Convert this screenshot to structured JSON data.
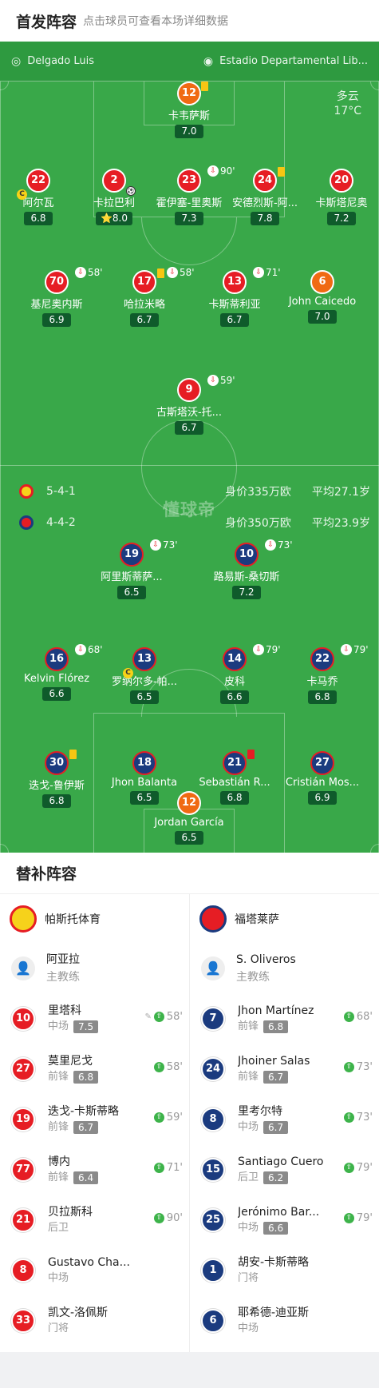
{
  "header": {
    "title": "首发阵容",
    "subtitle": "点击球员可查看本场详细数据"
  },
  "info": {
    "referee": "Delgado Luis",
    "stadium": "Estadio Departamental Lib..."
  },
  "weather": {
    "condition": "多云",
    "temp": "17°C"
  },
  "watermark": "懂球帝",
  "home_team": {
    "formation": "5-4-1",
    "value": "身价335万欧",
    "age": "平均27.1岁"
  },
  "away_team": {
    "formation": "4-4-2",
    "value": "身价350万欧",
    "age": "平均23.9岁"
  },
  "home": [
    {
      "num": "12",
      "name": "卡韦萨斯",
      "rating": "7.0"
    },
    {
      "num": "22",
      "name": "阿尔瓦",
      "rating": "6.8"
    },
    {
      "num": "2",
      "name": "卡拉巴利",
      "rating": "8.0",
      "star": "⭐"
    },
    {
      "num": "23",
      "name": "霍伊塞-里奥斯",
      "rating": "7.3",
      "sub": "90'"
    },
    {
      "num": "24",
      "name": "安德烈斯-阿...",
      "rating": "7.8"
    },
    {
      "num": "20",
      "name": "卡斯塔尼奥",
      "rating": "7.2"
    },
    {
      "num": "70",
      "name": "基尼奥内斯",
      "rating": "6.9",
      "sub": "58'"
    },
    {
      "num": "17",
      "name": "哈拉米略",
      "rating": "6.7",
      "sub": "58'"
    },
    {
      "num": "13",
      "name": "卡斯蒂利亚",
      "rating": "6.7",
      "sub": "71'"
    },
    {
      "num": "6",
      "name": "John Caicedo",
      "rating": "7.0"
    },
    {
      "num": "9",
      "name": "古斯塔沃-托...",
      "rating": "6.7",
      "sub": "59'"
    }
  ],
  "away": [
    {
      "num": "19",
      "name": "阿里斯蒂萨...",
      "rating": "6.5",
      "sub": "73'"
    },
    {
      "num": "10",
      "name": "路易斯-桑切斯",
      "rating": "7.2",
      "sub": "73'"
    },
    {
      "num": "16",
      "name": "Kelvin Flórez",
      "rating": "6.6",
      "sub": "68'"
    },
    {
      "num": "13",
      "name": "罗纳尔多-帕...",
      "rating": "6.5"
    },
    {
      "num": "14",
      "name": "皮科",
      "rating": "6.6",
      "sub": "79'"
    },
    {
      "num": "22",
      "name": "卡马乔",
      "rating": "6.8",
      "sub": "79'"
    },
    {
      "num": "30",
      "name": "迭戈-鲁伊斯",
      "rating": "6.8"
    },
    {
      "num": "18",
      "name": "Jhon Balanta",
      "rating": "6.5"
    },
    {
      "num": "21",
      "name": "Sebastián R...",
      "rating": "6.8"
    },
    {
      "num": "27",
      "name": "Cristián Mos...",
      "rating": "6.9"
    },
    {
      "num": "12",
      "name": "Jordan García",
      "rating": "6.5"
    }
  ],
  "subs": {
    "title": "替补阵容",
    "home_name": "帕斯托体育",
    "away_name": "福塔莱萨",
    "home_coach": {
      "name": "阿亚拉",
      "role": "主教练"
    },
    "away_coach": {
      "name": "S. Oliveros",
      "role": "主教练"
    },
    "home_list": [
      {
        "num": "10",
        "name": "里塔科",
        "pos": "中场",
        "rating": "7.5",
        "time": "58'"
      },
      {
        "num": "27",
        "name": "莫里尼戈",
        "pos": "前锋",
        "rating": "6.8",
        "time": "58'"
      },
      {
        "num": "19",
        "name": "迭戈-卡斯蒂略",
        "pos": "前锋",
        "rating": "6.7",
        "time": "59'"
      },
      {
        "num": "77",
        "name": "博内",
        "pos": "前锋",
        "rating": "6.4",
        "time": "71'"
      },
      {
        "num": "21",
        "name": "贝拉斯科",
        "pos": "后卫",
        "rating": "",
        "time": "90'"
      },
      {
        "num": "8",
        "name": "Gustavo Cha...",
        "pos": "中场",
        "rating": "",
        "time": ""
      },
      {
        "num": "33",
        "name": "凯文-洛佩斯",
        "pos": "门将",
        "rating": "",
        "time": ""
      }
    ],
    "away_list": [
      {
        "num": "7",
        "name": "Jhon Martínez",
        "pos": "前锋",
        "rating": "6.8",
        "time": "68'"
      },
      {
        "num": "24",
        "name": "Jhoiner Salas",
        "pos": "前锋",
        "rating": "6.7",
        "time": "73'"
      },
      {
        "num": "8",
        "name": "里考尔特",
        "pos": "中场",
        "rating": "6.7",
        "time": "73'"
      },
      {
        "num": "15",
        "name": "Santiago Cuero",
        "pos": "后卫",
        "rating": "6.2",
        "time": "79'"
      },
      {
        "num": "25",
        "name": "Jerónimo Bar...",
        "pos": "中场",
        "rating": "6.6",
        "time": "79'"
      },
      {
        "num": "1",
        "name": "胡安-卡斯蒂略",
        "pos": "门将",
        "rating": "",
        "time": ""
      },
      {
        "num": "6",
        "name": "耶希德-迪亚斯",
        "pos": "中场",
        "rating": "",
        "time": ""
      }
    ]
  },
  "colors": {
    "home": "#e61d24",
    "away": "#1b3b7f",
    "pitch": "#39a849"
  }
}
